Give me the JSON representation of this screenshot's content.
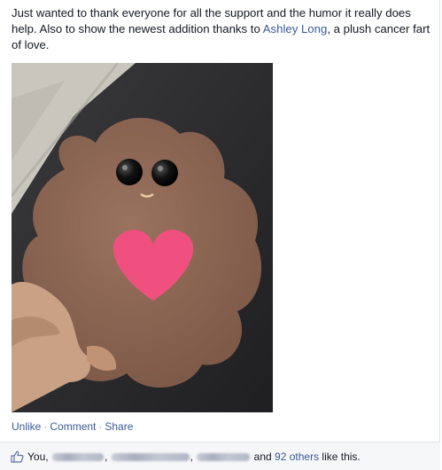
{
  "post": {
    "text_part1": "Just wanted to thank everyone for all the support and the humor it really does help. Also to show the newest addition thanks to ",
    "mention": "Ashley Long",
    "text_part2": ", a plush cancer fart of love."
  },
  "actions": {
    "unlike": "Unlike",
    "separator": "·",
    "comment": "Comment",
    "share": "Share"
  },
  "likes": {
    "prefix": "You,",
    "comma1": ",",
    "comma2": ",",
    "and": "and",
    "others_link": "92 others",
    "suffix": "like this."
  },
  "colors": {
    "link": "#3b5998",
    "muted": "#9197a3",
    "likes_bar_bg": "#f6f7f8",
    "plush_brown": "#8a6552",
    "heart_pink": "#f0507f"
  },
  "icons": {
    "like": "thumbs-up-icon"
  }
}
